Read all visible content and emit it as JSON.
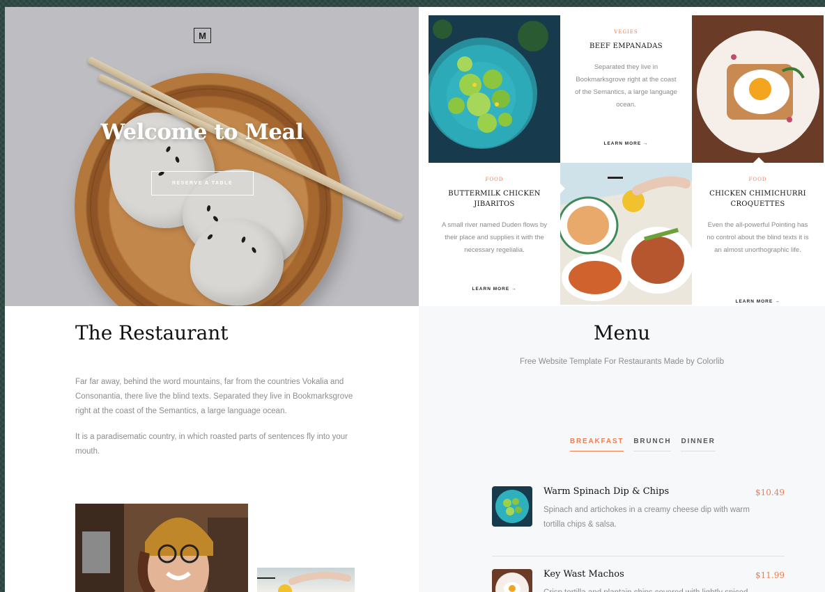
{
  "hero": {
    "logo": "M",
    "title": "Welcome to Meal",
    "reserve_label": "RESERVE A TABLE"
  },
  "grid": {
    "cards": [
      {
        "category": "VEGIES",
        "title": "BEEF EMPANADAS",
        "description": "Separated they live in Bookmarksgrove right at the coast of the Semantics, a large language ocean.",
        "link": "LEARN MORE →"
      },
      {
        "category": "FOOD",
        "title": "BUTTERMILK CHICKEN JIBARITOS",
        "description": "A small river named Duden flows by their place and supplies it with the necessary regelialia.",
        "link": "LEARN MORE →"
      },
      {
        "category": "FOOD",
        "title": "CHICKEN CHIMICHURRI CROQUETTES",
        "description": "Even the all-powerful Pointing has no control about the blind texts it is an almost unorthographic life.",
        "link": "LEARN MORE →"
      }
    ]
  },
  "restaurant": {
    "title": "The Restaurant",
    "paragraphs": [
      "Far far away, behind the word mountains, far from the countries Vokalia and Consonantia, there live the blind texts. Separated they live in Bookmarksgrove right at the coast of the Semantics, a large language ocean.",
      "It is a paradisematic country, in which roasted parts of sentences fly into your mouth."
    ]
  },
  "menu": {
    "title": "Menu",
    "subtitle": "Free Website Template For Restaurants Made by Colorlib",
    "tabs": [
      "BREAKFAST",
      "BRUNCH",
      "DINNER"
    ],
    "active_tab": "BREAKFAST",
    "items": [
      {
        "name": "Warm Spinach Dip & Chips",
        "price": "$10.49",
        "description": "Spinach and artichokes in a creamy cheese dip with warm tortilla chips & salsa."
      },
      {
        "name": "Key Wast Machos",
        "price": "$11.99",
        "description": "Crisp tortilla and plantain chips covered with lightly spiced"
      }
    ]
  },
  "colors": {
    "accent": "#f07c4d",
    "text_dark": "#111111",
    "text_muted": "#8c8c8c"
  }
}
